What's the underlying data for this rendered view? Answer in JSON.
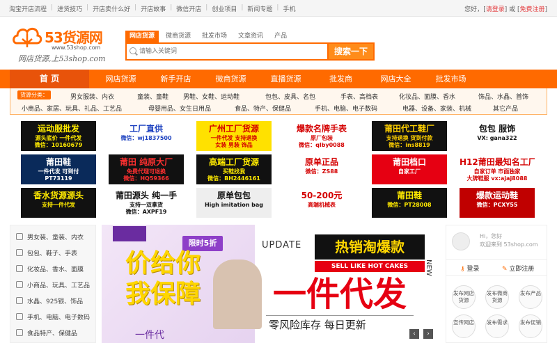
{
  "topbar": {
    "links": [
      "淘宝开店流程",
      "进货技巧",
      "开店卖什么好",
      "开店故事",
      "微信开店",
      "创业项目",
      "新闻专题",
      "手机"
    ],
    "greeting": "您好，",
    "login": "请登录",
    "or": "] 或 [",
    "register": "免费注册",
    "close": "]"
  },
  "logo": {
    "name": "53货源网",
    "url": "www.53shop.com",
    "slogan": "网店货源,上53shop.com"
  },
  "search": {
    "tabs": [
      "网店货源",
      "微商货源",
      "批发市场",
      "文章资讯",
      "产品"
    ],
    "placeholder": "请输入关键词",
    "button": "搜索一下"
  },
  "nav": {
    "home": "首 页",
    "items": [
      "网店货源",
      "新手开店",
      "微商货源",
      "直播货源",
      "批发商",
      "网店大全",
      "批发市场"
    ]
  },
  "categories": {
    "label": "货源分类：",
    "row1": [
      "男女服装、内衣",
      "童装、童鞋",
      "男鞋、女鞋、运动鞋",
      "包包、皮具、名包",
      "手表、高档表",
      "化妆品、面膜、香水",
      "饰品、水晶、首饰"
    ],
    "row2": [
      "小商品、家居、玩具、礼品、工艺品",
      "母婴用品、女生日用品",
      "食品、特产、保健品",
      "手机、电脑、电子数码",
      "电器、设备、家装、机械",
      "其它产品"
    ]
  },
  "ads": [
    {
      "l1": "运动服批发",
      "l2": "源头底价 一件代发",
      "l3": "微信：10160679",
      "bg": "#111",
      "fg": "#ffea00"
    },
    {
      "l1": "工厂直供",
      "l2": "微信：wj1837500",
      "l3": "",
      "bg": "#fff",
      "fg": "#1a3fbf"
    },
    {
      "l1": "广州工厂货源",
      "l2": "一件代发 支持退换",
      "l3": "女装 男装 饰品",
      "bg": "#ffe100",
      "fg": "#d40000"
    },
    {
      "l1": "爆款名牌手表",
      "l2": "原厂包装",
      "l3": "微信：qlby0088",
      "bg": "#fff",
      "fg": "#d40000"
    },
    {
      "l1": "莆田代工鞋厂",
      "l2": "支持退换 货到付款",
      "l3": "微信：ins8819",
      "bg": "#111",
      "fg": "#ffd000"
    },
    {
      "l1": "包包 服饰",
      "l2": "VX: gana322",
      "l3": "",
      "bg": "#fff",
      "fg": "#111"
    },
    {
      "l1": "莆田鞋",
      "l2": "一件代发 可到付",
      "l3": "PT73119",
      "bg": "#0a2a5a",
      "fg": "#fff"
    },
    {
      "l1": "莆田 纯原大厂",
      "l2": "免费代理可退换",
      "l3": "微信：HQ59366",
      "bg": "#111",
      "fg": "#ff3030"
    },
    {
      "l1": "高端工厂货源",
      "l2": "买鞋找我",
      "l3": "微信：BH2446161",
      "bg": "#111",
      "fg": "#ffea00"
    },
    {
      "l1": "原单正品",
      "l2": "微信：ZS88",
      "l3": "",
      "bg": "#fff",
      "fg": "#d40000"
    },
    {
      "l1": "莆田档口",
      "l2": "自家工厂",
      "l3": "",
      "bg": "#e60012",
      "fg": "#fff"
    },
    {
      "l1": "H12莆田最知名工厂",
      "l2": "自家订单 市面独家",
      "l3": "大牌鞋服 vx:ajaj8088",
      "bg": "#fff",
      "fg": "#d40000"
    },
    {
      "l1": "香水货源源头",
      "l2": "支持一件代发",
      "l3": "",
      "bg": "#111",
      "fg": "#ffea00"
    },
    {
      "l1": "莆田源头 纯一手",
      "l2": "支持一双拿货",
      "l3": "微信：AXPF19",
      "bg": "#fff",
      "fg": "#111"
    },
    {
      "l1": "原单包包",
      "l2": "High imitation bag",
      "l3": "",
      "bg": "#eee",
      "fg": "#111"
    },
    {
      "l1": "50-200元",
      "l2": "高端机械表",
      "l3": "",
      "bg": "#fff",
      "fg": "#d40000"
    },
    {
      "l1": "莆田鞋",
      "l2": "微信：PT28008",
      "l3": "",
      "bg": "#111",
      "fg": "#ffea00"
    },
    {
      "l1": "爆款运动鞋",
      "l2": "微信：PCXY55",
      "l3": "",
      "bg": "#c00000",
      "fg": "#fff"
    }
  ],
  "leftmenu": [
    "男女装、童装、内衣",
    "包包、鞋子、手表",
    "化妆品、香水、面膜",
    "小商品、玩具、工艺品",
    "水晶、925银、饰品",
    "手机、电脑、电子数码",
    "食品特产、保健品"
  ],
  "banner": {
    "tag": "限时5折",
    "big1": "价给你",
    "big2": "我保障",
    "update": "UPDATE",
    "hot": "热销淘爆款",
    "sell": "SELL LIKE HOT CAKES",
    "new": "NEW",
    "main": "一件代发",
    "sub": "零风险库存  每日更新",
    "small": "一件代"
  },
  "userpanel": {
    "hi": "Hi，您好",
    "welcome": "欢迎来到 53shop.com",
    "login": "登录",
    "register": "立即注册",
    "actions": [
      "发布网店货源",
      "发布微商货源",
      "发布产品",
      "宣传网店",
      "发布需求",
      "发布促销"
    ]
  }
}
